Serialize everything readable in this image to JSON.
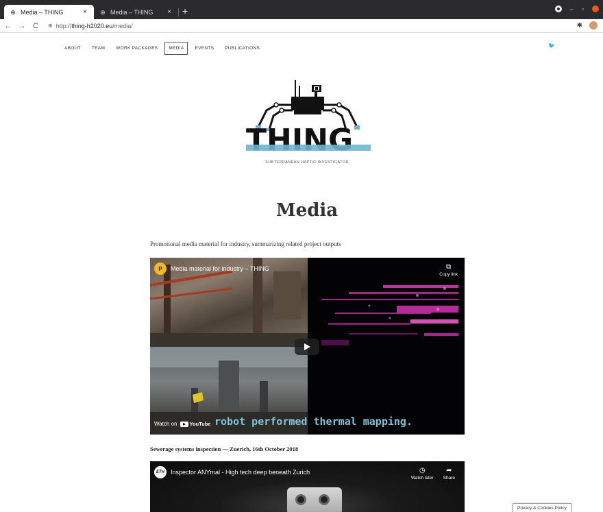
{
  "browser": {
    "tabs": [
      {
        "title": "Media – THING",
        "close": "×"
      },
      {
        "title": "Media – THING",
        "close": "×"
      }
    ],
    "new_tab": "+",
    "url_prefix": "http://",
    "url_host": "thing-h2020.eu",
    "url_path": "/media/"
  },
  "nav": {
    "items": [
      "About",
      "Team",
      "Work Packages",
      "Media",
      "Events",
      "Publications"
    ],
    "active": "Media"
  },
  "site": {
    "logo_text": "THING",
    "tagline": "SUBTERRANEAN HAPTIC INVESTIGATOR",
    "brand_colors": {
      "dark": "#111111",
      "accent": "#6fb6cf"
    }
  },
  "page": {
    "title": "Media",
    "intro": "Promotional media material for industry, summarizing related project outputs"
  },
  "video1": {
    "channel_initial": "P",
    "title": "Media material for industry – THING",
    "copy_link": "Copy link",
    "watch_on": "Watch on",
    "youtube": "YouTube",
    "subtitle": "robot performed thermal mapping."
  },
  "section2": {
    "caption": "Sewerage systems inspection — Zuerich, 16th October 2018"
  },
  "video2": {
    "channel_initial": "ETH",
    "title": "Inspector ANYmal - High tech deep beneath Zurich",
    "watch_later": "Watch later",
    "share": "Share"
  },
  "cookie": {
    "label": "Privacy & Cookies Policy"
  }
}
